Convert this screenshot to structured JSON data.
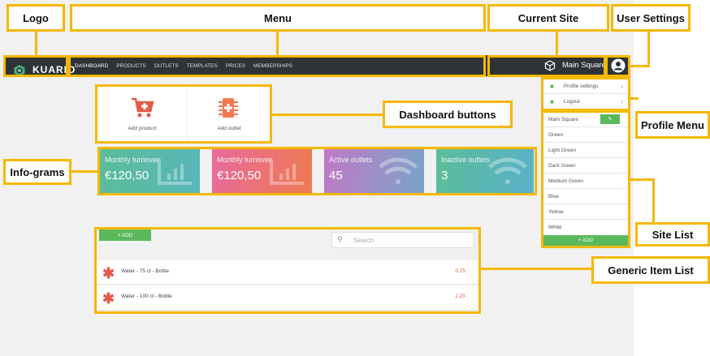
{
  "annotations": {
    "logo": "Logo",
    "menu": "Menu",
    "current_site": "Current Site",
    "user_settings": "User Settings",
    "dashboard_buttons": "Dashboard buttons",
    "info_grams": "Info-grams",
    "profile_menu": "Profile Menu",
    "site_list": "Site List",
    "generic_item_list": "Generic Item List"
  },
  "navbar": {
    "brand": "KUARIO",
    "menu": [
      "DASHBOARD",
      "PRODUCTS",
      "OUTLETS",
      "TEMPLATES",
      "PRICES",
      "MEMBERSHIPS"
    ],
    "current_site": "Main Square"
  },
  "dashboard_buttons": [
    {
      "label": "Add product",
      "icon": "cart-plus-icon"
    },
    {
      "label": "Add outlet",
      "icon": "chip-plus-icon"
    }
  ],
  "infograms": [
    {
      "title": "Monthly turnover",
      "value": "€120,50",
      "color": "#5bbd9a"
    },
    {
      "title": "Monthly turnover",
      "value": "€120,50",
      "color": "#e76b7a"
    },
    {
      "title": "Active outlets",
      "value": "45",
      "color": "#b27fc2"
    },
    {
      "title": "Inactive outlets",
      "value": "3",
      "color": "#5bbdc1"
    }
  ],
  "profile_menu": [
    "Profile settings",
    "Logout"
  ],
  "site_list": {
    "sites": [
      "Main Square",
      "Green",
      "Light Green",
      "Dark Green",
      "Medium Green",
      "Blue",
      "Yellow",
      "White"
    ],
    "add_label": "+ ADD"
  },
  "item_list": {
    "add_label": "+ ADD",
    "search_placeholder": "Search",
    "items": [
      {
        "name": "Water - 75 cl - Bottle",
        "price": "0,75"
      },
      {
        "name": "Water - 100 cl - Bottle",
        "price": "2,20"
      }
    ]
  },
  "colors": {
    "accent": "#f5b800",
    "navbar": "#2e3338",
    "green": "#5cb85c",
    "red": "#e55947"
  }
}
